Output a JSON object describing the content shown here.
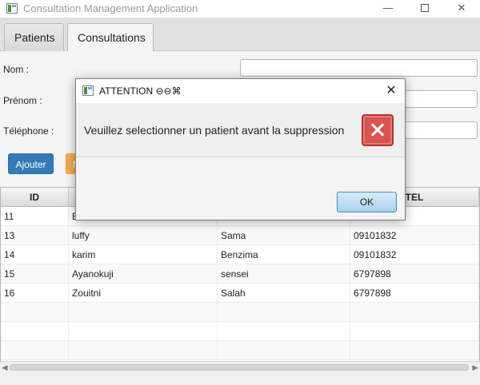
{
  "window": {
    "title": "Consultation Management Application"
  },
  "tabs": [
    {
      "label": "Patients"
    },
    {
      "label": "Consultations"
    }
  ],
  "form": {
    "nom_label": "Nom :",
    "prenom_label": "Prénom :",
    "telephone_label": "Téléphone :",
    "add_button": "Ajouter",
    "modify_button_visible": "M"
  },
  "table": {
    "columns": [
      "ID",
      "",
      "",
      "TEL"
    ],
    "rows": [
      [
        "11",
        "B",
        "",
        ""
      ],
      [
        "13",
        "luffy",
        "Sama",
        "09101832"
      ],
      [
        "14",
        "karim",
        "Benzima",
        "09101832"
      ],
      [
        "15",
        "Ayanokuji",
        "sensei",
        "6797898"
      ],
      [
        "16",
        "Zouitni",
        "Salah",
        "6797898"
      ]
    ]
  },
  "dialog": {
    "title": "ATTENTION ⊖⊖⌘",
    "message": "Veuillez selectionner un patient avant la suppression",
    "ok_label": "OK",
    "icon": "error-icon"
  },
  "colors": {
    "add_button": "#337ab7",
    "modify_button": "#f0ad4e",
    "error_icon": "#d9534f",
    "ok_button_border": "#3c8fce"
  }
}
